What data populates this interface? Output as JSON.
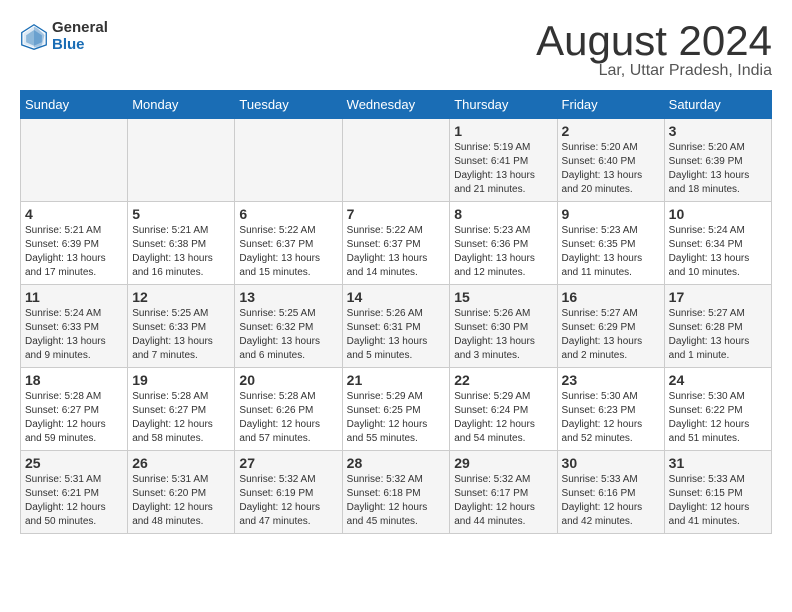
{
  "header": {
    "logo_general": "General",
    "logo_blue": "Blue",
    "month_title": "August 2024",
    "subtitle": "Lar, Uttar Pradesh, India"
  },
  "days_of_week": [
    "Sunday",
    "Monday",
    "Tuesday",
    "Wednesday",
    "Thursday",
    "Friday",
    "Saturday"
  ],
  "weeks": [
    [
      {
        "day": "",
        "info": ""
      },
      {
        "day": "",
        "info": ""
      },
      {
        "day": "",
        "info": ""
      },
      {
        "day": "",
        "info": ""
      },
      {
        "day": "1",
        "info": "Sunrise: 5:19 AM\nSunset: 6:41 PM\nDaylight: 13 hours\nand 21 minutes."
      },
      {
        "day": "2",
        "info": "Sunrise: 5:20 AM\nSunset: 6:40 PM\nDaylight: 13 hours\nand 20 minutes."
      },
      {
        "day": "3",
        "info": "Sunrise: 5:20 AM\nSunset: 6:39 PM\nDaylight: 13 hours\nand 18 minutes."
      }
    ],
    [
      {
        "day": "4",
        "info": "Sunrise: 5:21 AM\nSunset: 6:39 PM\nDaylight: 13 hours\nand 17 minutes."
      },
      {
        "day": "5",
        "info": "Sunrise: 5:21 AM\nSunset: 6:38 PM\nDaylight: 13 hours\nand 16 minutes."
      },
      {
        "day": "6",
        "info": "Sunrise: 5:22 AM\nSunset: 6:37 PM\nDaylight: 13 hours\nand 15 minutes."
      },
      {
        "day": "7",
        "info": "Sunrise: 5:22 AM\nSunset: 6:37 PM\nDaylight: 13 hours\nand 14 minutes."
      },
      {
        "day": "8",
        "info": "Sunrise: 5:23 AM\nSunset: 6:36 PM\nDaylight: 13 hours\nand 12 minutes."
      },
      {
        "day": "9",
        "info": "Sunrise: 5:23 AM\nSunset: 6:35 PM\nDaylight: 13 hours\nand 11 minutes."
      },
      {
        "day": "10",
        "info": "Sunrise: 5:24 AM\nSunset: 6:34 PM\nDaylight: 13 hours\nand 10 minutes."
      }
    ],
    [
      {
        "day": "11",
        "info": "Sunrise: 5:24 AM\nSunset: 6:33 PM\nDaylight: 13 hours\nand 9 minutes."
      },
      {
        "day": "12",
        "info": "Sunrise: 5:25 AM\nSunset: 6:33 PM\nDaylight: 13 hours\nand 7 minutes."
      },
      {
        "day": "13",
        "info": "Sunrise: 5:25 AM\nSunset: 6:32 PM\nDaylight: 13 hours\nand 6 minutes."
      },
      {
        "day": "14",
        "info": "Sunrise: 5:26 AM\nSunset: 6:31 PM\nDaylight: 13 hours\nand 5 minutes."
      },
      {
        "day": "15",
        "info": "Sunrise: 5:26 AM\nSunset: 6:30 PM\nDaylight: 13 hours\nand 3 minutes."
      },
      {
        "day": "16",
        "info": "Sunrise: 5:27 AM\nSunset: 6:29 PM\nDaylight: 13 hours\nand 2 minutes."
      },
      {
        "day": "17",
        "info": "Sunrise: 5:27 AM\nSunset: 6:28 PM\nDaylight: 13 hours\nand 1 minute."
      }
    ],
    [
      {
        "day": "18",
        "info": "Sunrise: 5:28 AM\nSunset: 6:27 PM\nDaylight: 12 hours\nand 59 minutes."
      },
      {
        "day": "19",
        "info": "Sunrise: 5:28 AM\nSunset: 6:27 PM\nDaylight: 12 hours\nand 58 minutes."
      },
      {
        "day": "20",
        "info": "Sunrise: 5:28 AM\nSunset: 6:26 PM\nDaylight: 12 hours\nand 57 minutes."
      },
      {
        "day": "21",
        "info": "Sunrise: 5:29 AM\nSunset: 6:25 PM\nDaylight: 12 hours\nand 55 minutes."
      },
      {
        "day": "22",
        "info": "Sunrise: 5:29 AM\nSunset: 6:24 PM\nDaylight: 12 hours\nand 54 minutes."
      },
      {
        "day": "23",
        "info": "Sunrise: 5:30 AM\nSunset: 6:23 PM\nDaylight: 12 hours\nand 52 minutes."
      },
      {
        "day": "24",
        "info": "Sunrise: 5:30 AM\nSunset: 6:22 PM\nDaylight: 12 hours\nand 51 minutes."
      }
    ],
    [
      {
        "day": "25",
        "info": "Sunrise: 5:31 AM\nSunset: 6:21 PM\nDaylight: 12 hours\nand 50 minutes."
      },
      {
        "day": "26",
        "info": "Sunrise: 5:31 AM\nSunset: 6:20 PM\nDaylight: 12 hours\nand 48 minutes."
      },
      {
        "day": "27",
        "info": "Sunrise: 5:32 AM\nSunset: 6:19 PM\nDaylight: 12 hours\nand 47 minutes."
      },
      {
        "day": "28",
        "info": "Sunrise: 5:32 AM\nSunset: 6:18 PM\nDaylight: 12 hours\nand 45 minutes."
      },
      {
        "day": "29",
        "info": "Sunrise: 5:32 AM\nSunset: 6:17 PM\nDaylight: 12 hours\nand 44 minutes."
      },
      {
        "day": "30",
        "info": "Sunrise: 5:33 AM\nSunset: 6:16 PM\nDaylight: 12 hours\nand 42 minutes."
      },
      {
        "day": "31",
        "info": "Sunrise: 5:33 AM\nSunset: 6:15 PM\nDaylight: 12 hours\nand 41 minutes."
      }
    ]
  ]
}
